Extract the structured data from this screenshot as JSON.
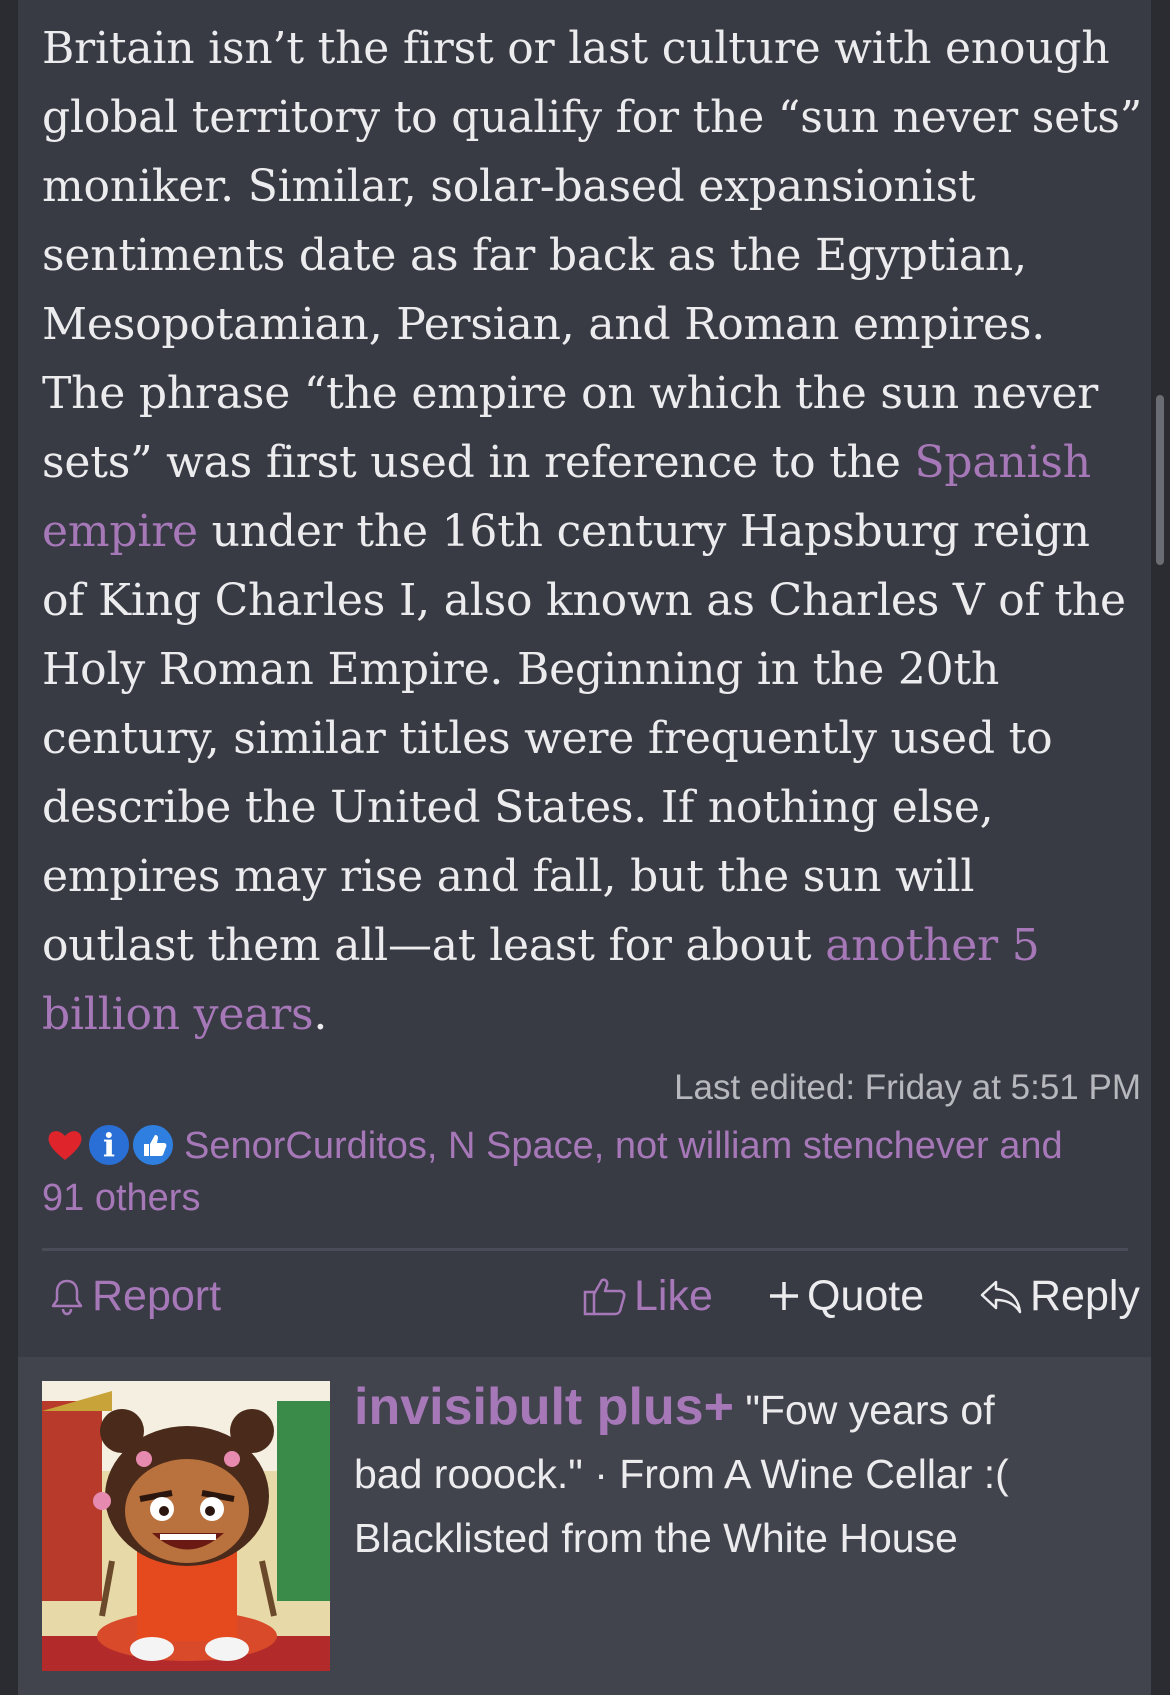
{
  "post": {
    "body_lines": [
      "Britain isn’t the first or last culture with enough",
      "global territory to qualify for the “sun never sets”",
      "moniker. Similar, solar-based expansionist",
      "sentiments date as far back as the Egyptian,",
      "Mesopotamian, Persian, and Roman empires.",
      "The phrase “the empire on which the sun never"
    ],
    "line7_before": "sets” was first used in reference to the ",
    "link_spanish_1": "Spanish",
    "link_spanish_2": "empire",
    "line8_after": " under the 16th century Hapsburg reign",
    "body_lines_2": [
      "of King Charles I, also known as Charles V of the",
      "Holy Roman Empire. Beginning in the 20th",
      "century, similar titles were frequently used to",
      "describe the United States. If nothing else,",
      "empires may rise and fall, but the sun will"
    ],
    "line14_before": "outlast them all—at least for about ",
    "link_billion_1": "another 5",
    "link_billion_2": "billion years",
    "line15_after": ".",
    "last_edited": "Last edited: Friday at 5:51 PM",
    "reactions_users": "SenorCurditos, N Space, not william stenchever and",
    "reactions_more": "91 others",
    "actions": {
      "report": "Report",
      "like": "Like",
      "quote": "Quote",
      "reply": "Reply"
    }
  },
  "next_post": {
    "username": "invisibult plus+",
    "user_title": " \"Fow years of",
    "user_title_2": "bad rooock.\" · From A Wine Cellar :(",
    "user_title_3": "Blacklisted from the White House"
  },
  "colors": {
    "accent": "#a678b8",
    "background": "#383a44",
    "text": "#ececee"
  }
}
